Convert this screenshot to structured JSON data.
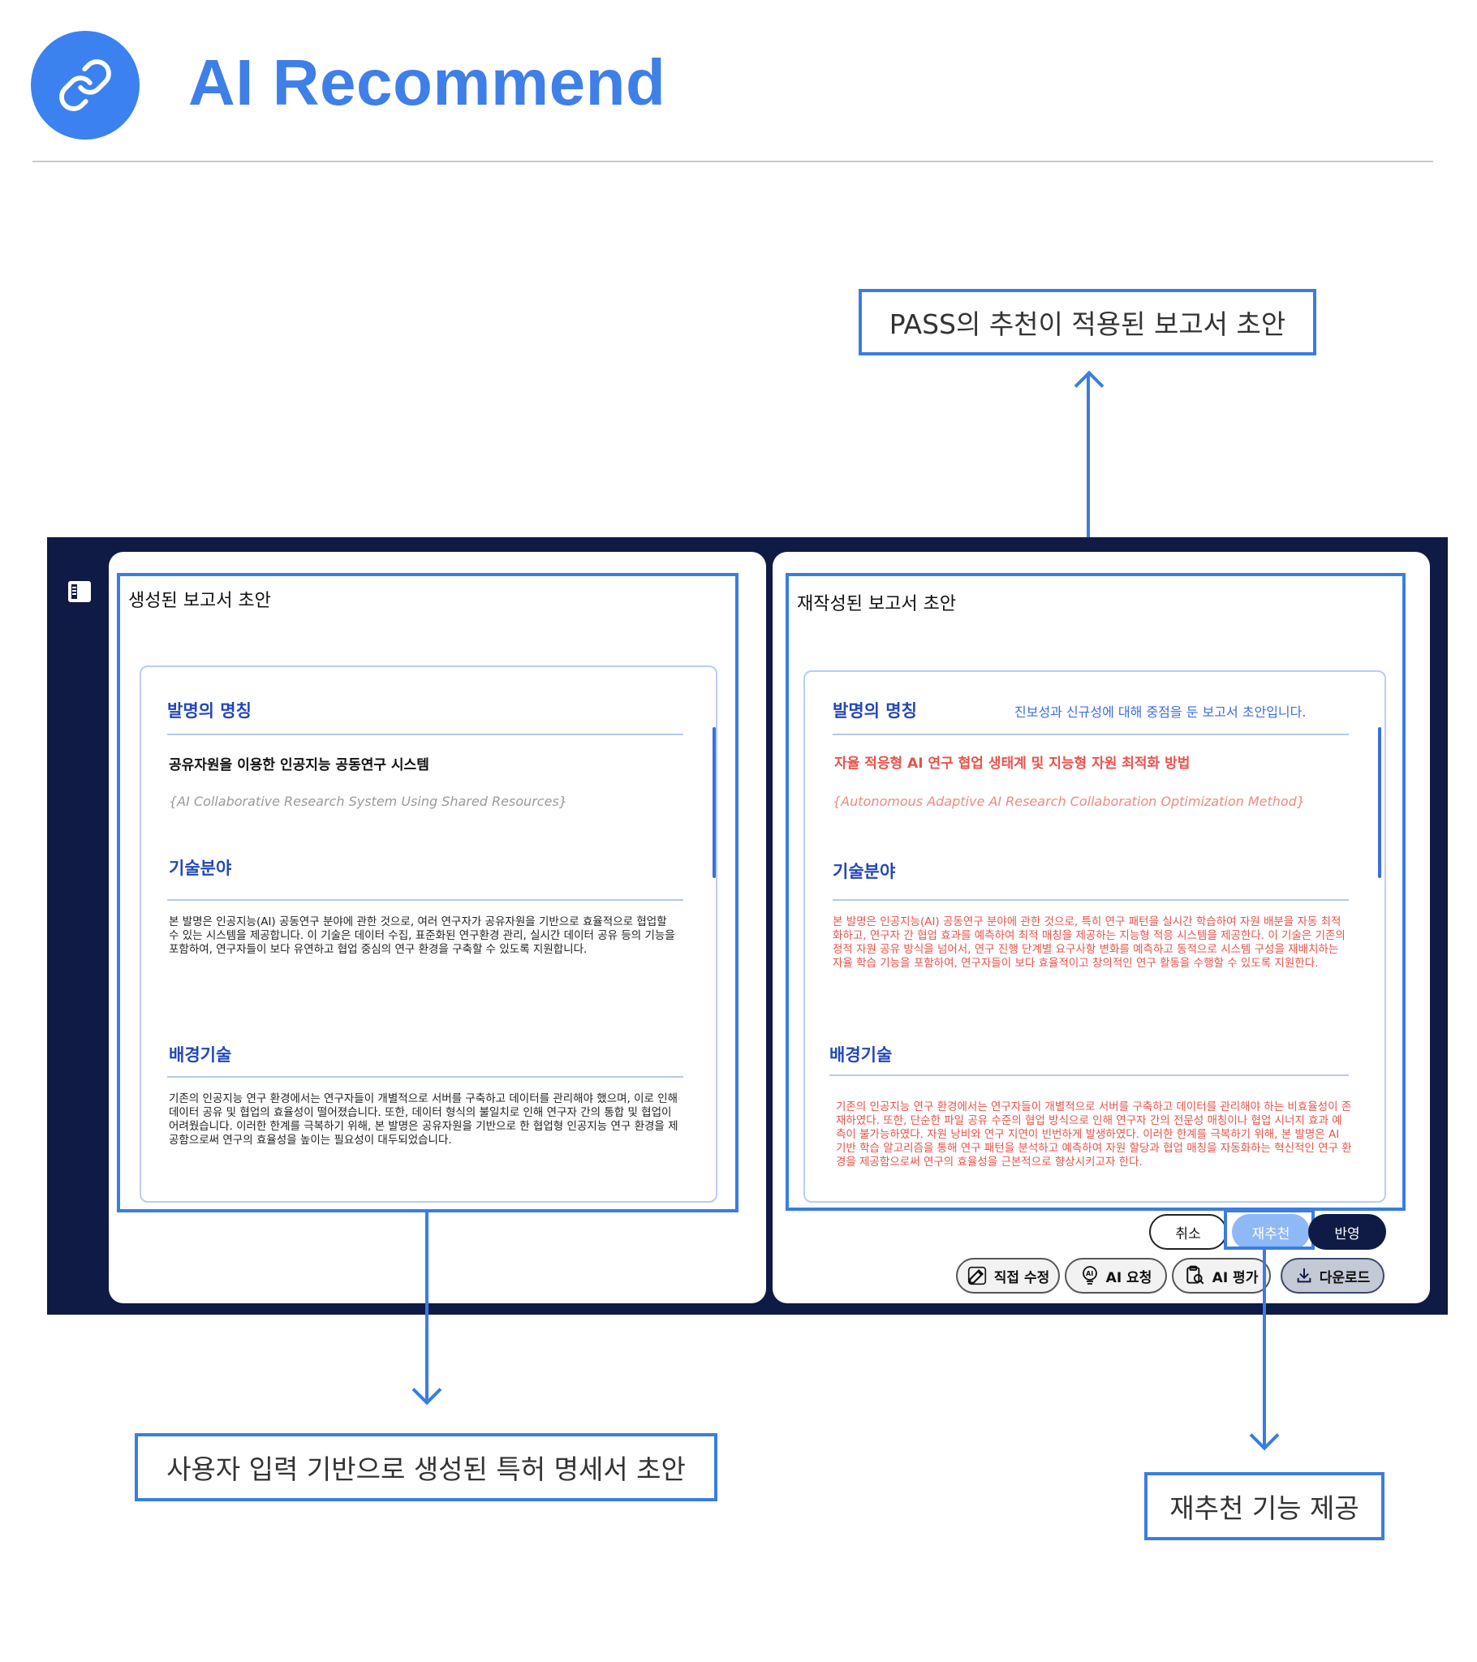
{
  "header": {
    "title": "AI Recommend",
    "logo_icon": "link-icon"
  },
  "callouts": {
    "top": "PASS의 추천이 적용된 보고서 초안",
    "bottom_left": "사용자 입력 기반으로 생성된 특허 명세서 초안",
    "bottom_right": "재추천 기능 제공"
  },
  "left_panel": {
    "title": "생성된 보고서 초안",
    "sections": {
      "name_heading": "발명의 명칭",
      "name_ko": "공유자원을 이용한 인공지능 공동연구 시스템",
      "name_en": "{AI Collaborative Research System Using Shared Resources}",
      "field_heading": "기술분야",
      "field_text": "본 발명은 인공지능(AI) 공동연구 분야에 관한 것으로, 여러 연구자가 공유자원을 기반으로 효율적으로 협업할 수 있는 시스템을 제공합니다. 이 기술은 데이터 수집, 표준화된 연구환경 관리, 실시간 데이터 공유 등의 기능을 포함하여, 연구자들이 보다 유연하고 협업 중심의 연구 환경을 구축할 수 있도록 지원합니다.",
      "background_heading": "배경기술",
      "background_text": "기존의 인공지능 연구 환경에서는 연구자들이 개별적으로 서버를 구축하고 데이터를 관리해야 했으며, 이로 인해 데이터 공유 및 협업의 효율성이 떨어졌습니다. 또한, 데이터 형식의 불일치로 인해 연구자 간의 통합 및 협업이 어려웠습니다. 이러한 한계를 극복하기 위해, 본 발명은 공유자원을 기반으로 한 협업형 인공지능 연구 환경을 제공함으로써 연구의 효율성을 높이는 필요성이 대두되었습니다."
    }
  },
  "right_panel": {
    "title": "재작성된 보고서 초안",
    "note": "진보성과 신규성에 대해 중점을 둔 보고서 초안입니다.",
    "sections": {
      "name_heading": "발명의 명칭",
      "name_ko": "자율 적응형 AI 연구 협업 생태계 및 지능형 자원 최적화 방법",
      "name_en": "{Autonomous Adaptive AI Research Collaboration Optimization Method}",
      "field_heading": "기술분야",
      "field_text": "본 발명은 인공지능(AI) 공동연구 분야에 관한 것으로, 특히 연구 패턴을 실시간 학습하여 자원 배분을 자동 최적화하고, 연구자 간 협업 효과를 예측하여 최적 매칭을 제공하는 지능형 적응 시스템을 제공한다. 이 기술은 기존의 정적 자원 공유 방식을 넘어서, 연구 진행 단계별 요구사항 변화를 예측하고 동적으로 시스템 구성을 재배치하는 자율 학습 기능을 포함하여, 연구자들이 보다 효율적이고 창의적인 연구 활동을 수행할 수 있도록 지원한다.",
      "background_heading": "배경기술",
      "background_text": "기존의 인공지능 연구 환경에서는 연구자들이 개별적으로 서버를 구축하고 데이터를 관리해야 하는 비효율성이 존재하였다. 또한, 단순한 파일 공유 수준의 협업 방식으로 인해 연구자 간의 전문성 매칭이나 협업 시너지 효과 예측이 불가능하였다. 자원 낭비와 연구 지연이 빈번하게 발생하였다. 이러한 한계를 극복하기 위해, 본 발명은 AI 기반 학습 알고리즘을 통해 연구 패턴을 분석하고 예측하여 자원 할당과 협업 매칭을 자동화하는 혁신적인 연구 환경을 제공함으로써 연구의 효율성을 근본적으로 향상시키고자 한다."
    },
    "actions": {
      "cancel": "취소",
      "re_recommend": "재추천",
      "apply": "반영"
    },
    "toolbar": {
      "edit": "직접 수정",
      "ai_request": "AI 요청",
      "ai_eval": "AI 평가",
      "download": "다운로드"
    }
  },
  "colors": {
    "accent": "#3b7de0",
    "navy": "#0f1b45",
    "heading": "#2347b8",
    "rewritten": "#e9534b"
  }
}
